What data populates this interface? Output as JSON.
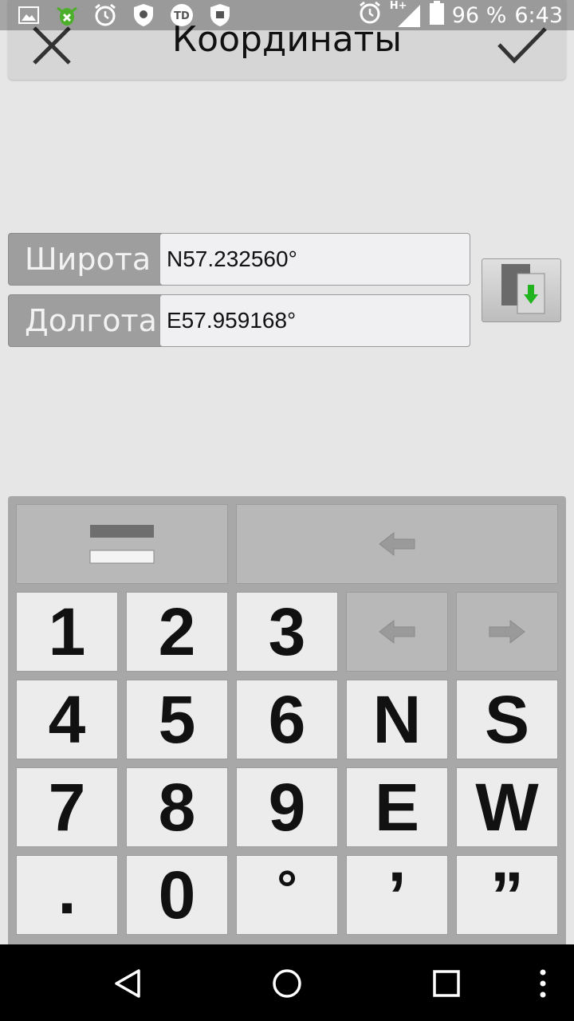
{
  "status_bar": {
    "battery_text": "96 %",
    "time": "6:43",
    "network_label": "H+",
    "icons": [
      "image-icon",
      "bug-icon",
      "alarm-icon",
      "shield-icon",
      "td-icon",
      "shield-check-icon",
      "alarm-icon",
      "signal-icon",
      "battery-icon"
    ]
  },
  "header": {
    "title": "Координаты",
    "close_icon": "close-icon",
    "confirm_icon": "check-icon"
  },
  "coordinates": {
    "latitude": {
      "label": "Широта",
      "value": "N57.232560°"
    },
    "longitude": {
      "label": "Долгота",
      "value": "E57.959168°"
    },
    "paste_icon": "paste-icon"
  },
  "keypad": {
    "keys": {
      "k1": "1",
      "k2": "2",
      "k3": "3",
      "k4": "4",
      "k5": "5",
      "k6": "6",
      "kN": "N",
      "kS": "S",
      "k7": "7",
      "k8": "8",
      "k9": "9",
      "kE": "E",
      "kW": "W",
      "kDot": ".",
      "k0": "0",
      "kDeg": "°",
      "kMin": "’",
      "kSec": "”"
    },
    "icons": [
      "switch-line-icon",
      "backspace-icon",
      "cursor-left-icon",
      "cursor-right-icon"
    ]
  },
  "colors": {
    "paste_arrow": "#22b41e",
    "keypad_bg": "#a8a8a8",
    "key_bg": "#ececec"
  },
  "navbar": {
    "icons": [
      "back-icon",
      "home-icon",
      "recents-icon",
      "menu-icon"
    ]
  }
}
